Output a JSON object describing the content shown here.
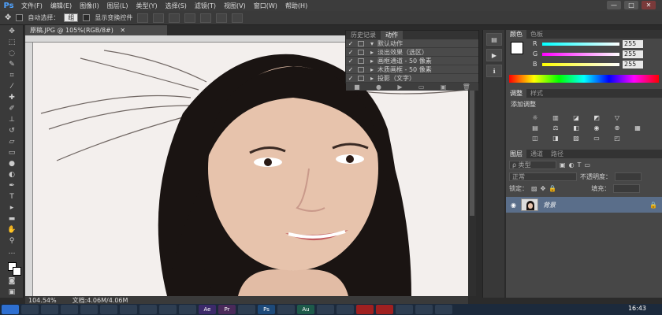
{
  "app": {
    "logo": "Ps"
  },
  "menu": [
    "文件(F)",
    "编辑(E)",
    "图像(I)",
    "图层(L)",
    "类型(Y)",
    "选择(S)",
    "滤镜(T)",
    "视图(V)",
    "窗口(W)",
    "帮助(H)"
  ],
  "window_controls": [
    "—",
    "□",
    "✕"
  ],
  "options": {
    "auto_select_label": "自动选择：",
    "auto_select_value": "组",
    "show_transform_label": "显示变换控件"
  },
  "document": {
    "tab_title": "原稿.JPG @ 105%(RGB/8#)",
    "close": "✕",
    "zoom": "104.54%",
    "doc_info": "文档:4.06M/4.06M"
  },
  "actions_panel": {
    "tabs": [
      "历史记录",
      "动作"
    ],
    "rows": [
      {
        "check": "✓",
        "expand": "▾",
        "label": "默认动作"
      },
      {
        "check": "✓",
        "expand": "▸",
        "label": "淡出效果（选区）"
      },
      {
        "check": "✓",
        "expand": "▸",
        "label": "画框通道 - 50 像素"
      },
      {
        "check": "✓",
        "expand": "▸",
        "label": "木质画框 - 50 像素"
      },
      {
        "check": "✓",
        "expand": "▸",
        "label": "投影（文字）"
      }
    ]
  },
  "color_panel": {
    "tabs": [
      "颜色",
      "色板"
    ],
    "channels": [
      {
        "label": "R",
        "value": "255",
        "grad": "linear-gradient(90deg,#00ffff,#ffffff)"
      },
      {
        "label": "G",
        "value": "255",
        "grad": "linear-gradient(90deg,#ff00ff,#ffffff)"
      },
      {
        "label": "B",
        "value": "255",
        "grad": "linear-gradient(90deg,#ffff00,#ffffff)"
      }
    ]
  },
  "adjust_panel": {
    "tabs": [
      "调整",
      "样式"
    ],
    "title": "添加调整"
  },
  "layers_panel": {
    "tabs": [
      "图层",
      "通道",
      "路径"
    ],
    "filter": "ρ 类型",
    "blend_mode": "正常",
    "opacity_label": "不透明度：",
    "lock_label": "锁定：",
    "fill_label": "填充：",
    "layer_name": "背景"
  },
  "taskbar": {
    "items": [
      "",
      "",
      "",
      "",
      "",
      "",
      "",
      "",
      "",
      "",
      "Ae",
      "Pr",
      "",
      "Ps",
      "",
      "Au",
      "",
      "",
      "",
      "",
      "",
      "",
      ""
    ],
    "clock": "16:43"
  }
}
